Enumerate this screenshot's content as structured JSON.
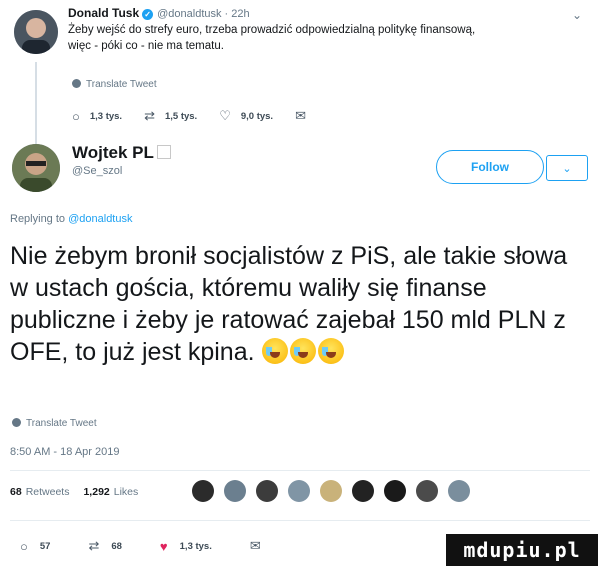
{
  "parent_tweet": {
    "author_name": "Donald Tusk",
    "handle_time": "@donaldtusk · 22h",
    "text_line1": "Żeby wejść do strefy euro, trzeba prowadzić odpowiedzialną politykę finansową,",
    "text_line2": "więc - póki co - nie ma tematu.",
    "translate_label": "Translate Tweet",
    "replies": "1,3 tys.",
    "retweets": "1,5 tys.",
    "likes": "9,0 tys."
  },
  "reply_tweet": {
    "author_name": "Wojtek PL",
    "handle": "@Se_szol",
    "follow_label": "Follow",
    "replying_prefix": "Replying to",
    "replying_to": "@donaldtusk",
    "text": "Nie żebym bronił socjalistów z PiS, ale takie słowa w ustach gościa, któremu waliły się finanse publiczne i żeby je ratować zajebał 150 mld PLN z OFE, to już jest kpina.",
    "translate_label": "Translate Tweet",
    "timestamp": "8:50 AM - 18 Apr 2019",
    "retweets_count": "68",
    "retweets_label": "Retweets",
    "likes_count": "1,292",
    "likes_label": "Likes",
    "action_replies": "57",
    "action_retweets": "68",
    "action_likes": "1,3 tys."
  },
  "icons": {
    "verified": "verified-badge-icon",
    "chevron": "chevron-down-icon",
    "reply": "reply-icon",
    "retweet": "retweet-icon",
    "like": "heart-icon",
    "dm": "envelope-icon",
    "translate": "globe-icon",
    "emoji": "face-with-tears-of-joy-icon"
  },
  "colors": {
    "accent": "#1da1f2",
    "like": "#e0245e",
    "muted": "#657786"
  },
  "watermark": "mdupiu.pl"
}
